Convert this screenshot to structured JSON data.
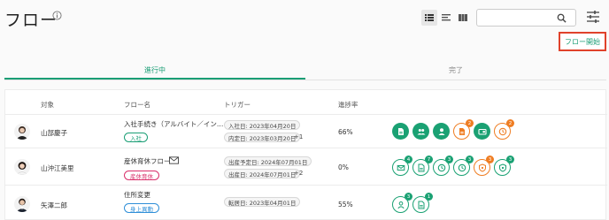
{
  "header": {
    "title": "フロー"
  },
  "search": {
    "placeholder": ""
  },
  "actions": {
    "start_flow_label": "フロー開始"
  },
  "tabs": [
    {
      "label": "進行中",
      "active": true
    },
    {
      "label": "完了",
      "active": false
    }
  ],
  "table": {
    "columns": [
      "対象",
      "フロー名",
      "トリガー",
      "進捗率"
    ],
    "rows": [
      {
        "name": "山部慶子",
        "flow_name": "入社手続き（アルバイト／イン…",
        "tag": "入社",
        "triggers": [
          "入社日: 2023年04月20日",
          "内定日: 2023年03月20日"
        ],
        "more": "+1",
        "progress": "66%",
        "steps": [
          {
            "icon": "document-icon",
            "style": "green",
            "badge": ""
          },
          {
            "icon": "group-icon",
            "style": "green",
            "badge": ""
          },
          {
            "icon": "person-icon",
            "style": "green",
            "badge": ""
          },
          {
            "icon": "form-icon",
            "style": "orange",
            "badge": "2"
          },
          {
            "icon": "card-icon",
            "style": "green",
            "badge": ""
          },
          {
            "icon": "clock-icon",
            "style": "orange",
            "badge": "2"
          }
        ]
      },
      {
        "name": "山沖江美里",
        "flow_name": "産休育休フロー",
        "tag": "産休育休",
        "triggers": [
          "出産予定日: 2024年07月01日",
          "出産日: 2024年07月01日"
        ],
        "more": "+2",
        "progress": "0%",
        "steps": [
          {
            "icon": "mail-icon",
            "style": "green-o",
            "badge": "4"
          },
          {
            "icon": "form-icon",
            "style": "green-o",
            "badge": "7"
          },
          {
            "icon": "clock-icon",
            "style": "green-o",
            "badge": "3"
          },
          {
            "icon": "clock-icon",
            "style": "green-o",
            "badge": "3"
          },
          {
            "icon": "shield-icon",
            "style": "orange",
            "badge": "3"
          },
          {
            "icon": "shield-icon",
            "style": "green-o",
            "badge": "3"
          }
        ]
      },
      {
        "name": "矢澤二郎",
        "flow_name": "住所変更",
        "tag": "身上異動",
        "triggers": [
          "転居日: 2023年04月01日"
        ],
        "more": "",
        "progress": "55%",
        "steps": [
          {
            "icon": "person-icon",
            "style": "green-o",
            "badge": "3"
          },
          {
            "icon": "form-icon",
            "style": "green-o",
            "badge": "1"
          }
        ]
      }
    ]
  },
  "colors": {
    "accent": "#1a9e75",
    "orange": "#ef7d22",
    "highlight": "#e0422b"
  }
}
